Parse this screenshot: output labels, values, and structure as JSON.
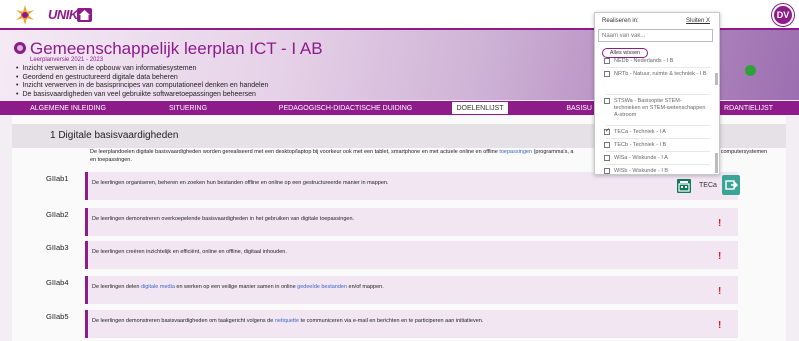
{
  "app": {
    "logo_text": "UNIK",
    "user_initials": "DV",
    "brand_color": "#8e1b8a"
  },
  "header": {
    "title": "Gemeenschappelijk leerplan ICT - I AB",
    "version": "Leerplanversie 2021 - 2023",
    "bullets": [
      "Inzicht verwerven in de opbouw van informatiesystemen",
      "Geordend en gestructureerd digitale data beheren",
      "Inzicht verwerven in de basisprincipes van computationeel denken en handelen",
      "De basisvaardigheden van veel gebruikte softwaretoepassingen beheersen"
    ]
  },
  "nav": {
    "tabs": [
      {
        "label": "ALGEMENE INLEIDING",
        "active": false
      },
      {
        "label": "SITUERING",
        "active": false
      },
      {
        "label": "PEDAGOGISCH-DIDACTISCHE DUIDING",
        "active": false
      },
      {
        "label": "DOELENLIJST",
        "active": true
      },
      {
        "label": "BASISU",
        "active": false
      },
      {
        "label": "",
        "active": false
      },
      {
        "label": "RDANTIELIJST",
        "active": false
      }
    ]
  },
  "section": {
    "title": "1 Digitale basisvaardigheden",
    "intro_before": "De leerplandoelen digitale basisvaardigheden worden gerealiseerd met een desktop/laptop bij voorkeur ook met een tablet, smartphone en met actuele online en offline ",
    "intro_link": "toepassingen",
    "intro_after": " (programma's, a",
    "intro_right": "met computersystemen",
    "intro_line2": "en toepassingen."
  },
  "goals": [
    {
      "code": "GIIab1",
      "text": "De leerlingen organiseren, beheren en zoeken hun bestanden offline en online op een gestructureerde manier in mappen."
    },
    {
      "code": "GIIab2",
      "text": "De leerlingen demonstreren overkoepelende basisvaardigheden in het gebruiken van digitale toepassingen."
    },
    {
      "code": "GIIab3",
      "text": "De leerlingen creëren inzichtelijk en efficiënt, online en offline, digitaal inhouden."
    },
    {
      "code": "GIIab4",
      "text_before": "De leerlingen delen ",
      "link1": "digitale media",
      "text_mid": " en werken op een veilige manier samen in online ",
      "link2": "gedeelde bestanden",
      "text_after": " en/of mappen."
    },
    {
      "code": "GIIab5",
      "text_before": "De leerlingen demonstreren basisvaardigheden om taakgericht volgens de ",
      "link1": "netiquette",
      "text_after": " te communiceren via e-mail en berichten en te participeren aan initiatieven."
    }
  ],
  "exclamation": "!",
  "teca_label": "TECa",
  "dropdown": {
    "heading": "Realiseren in:",
    "close_label": "Sluiten X",
    "search_placeholder": "Naam van vak...",
    "clear_label": "Alles wissen",
    "items": [
      {
        "label": "NEDb - Nederlands - I B",
        "checked": false
      },
      {
        "label": "NRTb - Natuur, ruimte & techniek - I B",
        "checked": false
      },
      {
        "label": "STSWa - Basisoptie STEM-technieken en STEM-wetenschappen A-stroom",
        "checked": false
      },
      {
        "label": "TECa - Techniek - I A",
        "checked": true
      },
      {
        "label": "TECb - Techniek - I B",
        "checked": false
      },
      {
        "label": "WISa - Wiskunde - I A",
        "checked": false
      },
      {
        "label": "WISb - Wiskunde - I B",
        "checked": false
      }
    ]
  }
}
